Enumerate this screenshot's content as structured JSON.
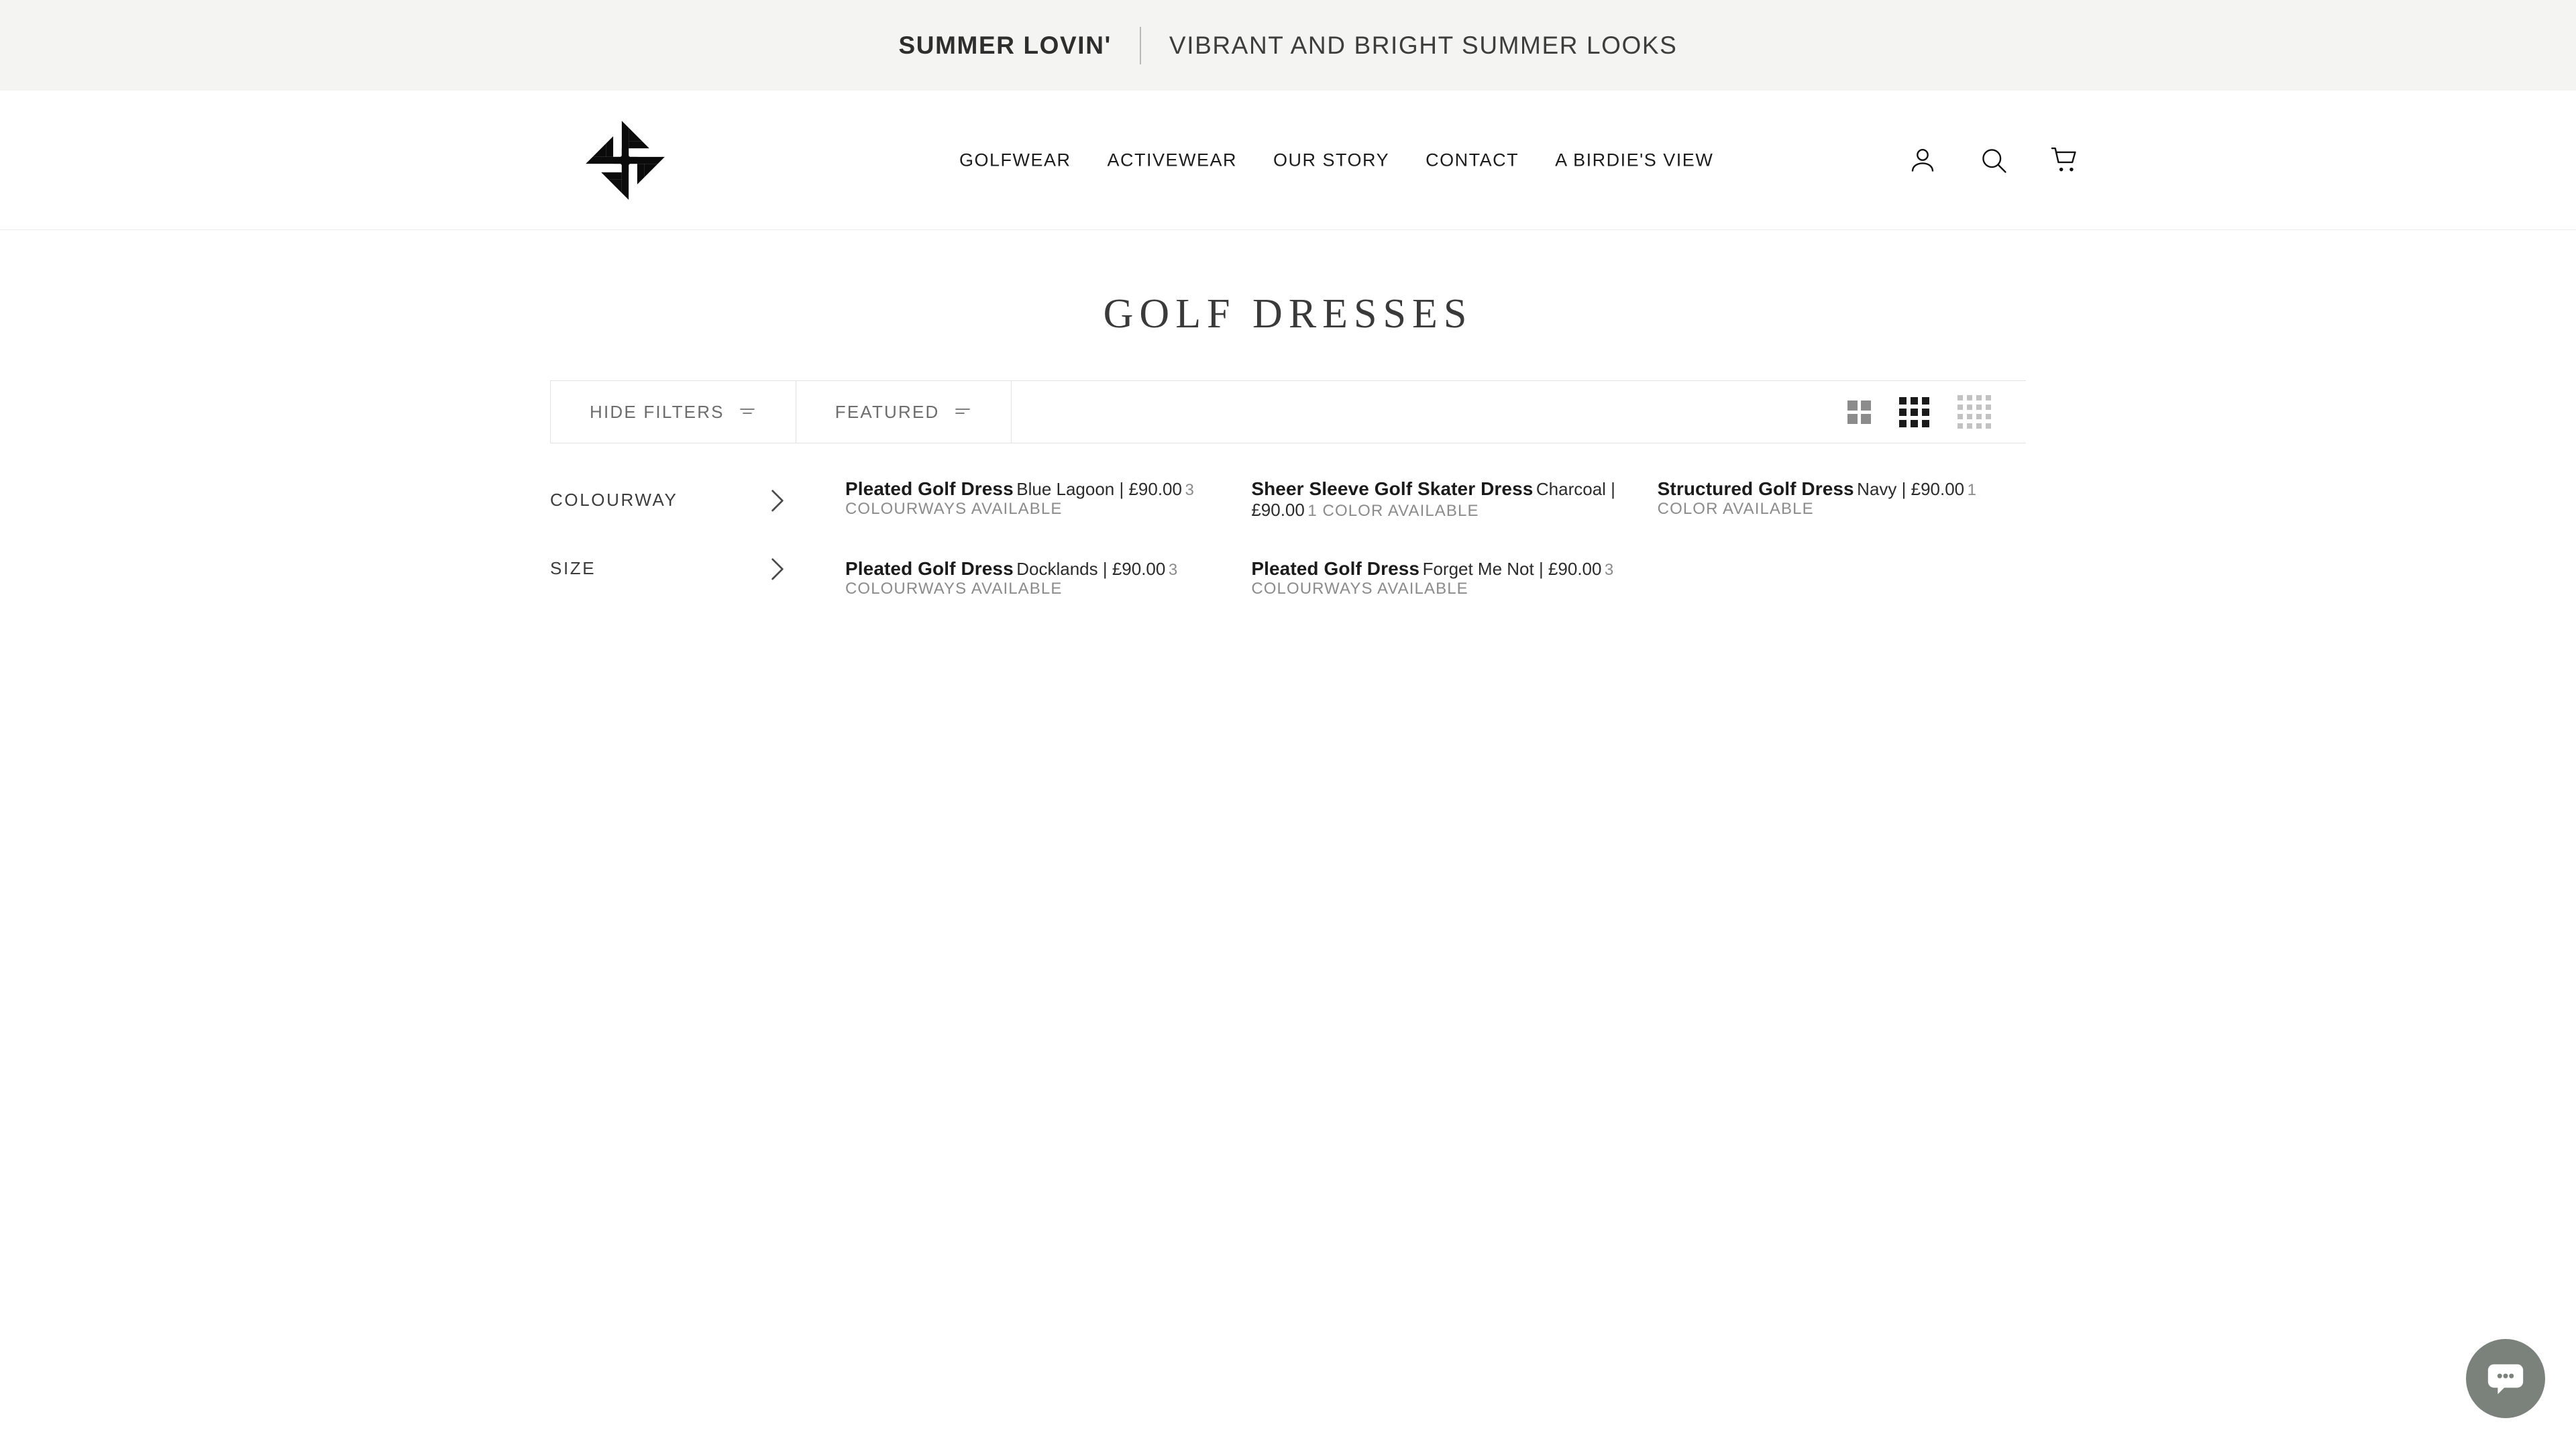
{
  "announcement": {
    "strong_text": "SUMMER LOVIN'",
    "light_text": "VIBRANT AND BRIGHT SUMMER LOOKS"
  },
  "header": {
    "logo_name": "pinwheel-knot-logo",
    "nav": [
      {
        "label": "GOLFWEAR"
      },
      {
        "label": "ACTIVEWEAR"
      },
      {
        "label": "OUR STORY"
      },
      {
        "label": "CONTACT"
      },
      {
        "label": "A BIRDIE'S VIEW"
      }
    ],
    "icons": {
      "account": "account-icon",
      "search": "search-icon",
      "cart": "cart-icon"
    }
  },
  "page": {
    "title": "GOLF DRESSES"
  },
  "filter_bar": {
    "hide_filters_label": "HIDE FILTERS",
    "sort_label": "FEATURED",
    "view_modes": [
      {
        "name": "grid-2-columns",
        "cols": 2,
        "active": false
      },
      {
        "name": "grid-3-columns",
        "cols": 3,
        "active": true
      },
      {
        "name": "grid-4-columns",
        "cols": 4,
        "active": false
      }
    ]
  },
  "sidebar": {
    "filters": [
      {
        "label": "COLOURWAY"
      },
      {
        "label": "SIZE"
      }
    ]
  },
  "products": [
    {
      "title": "Pleated Golf Dress",
      "variant": "Blue Lagoon | £90.00",
      "colors": "3 COLOURWAYS AVAILABLE",
      "scene": "blue-shutters"
    },
    {
      "title": "Sheer Sleeve Golf Skater Dress",
      "variant": "Charcoal | £90.00",
      "colors": "1 COLOR AVAILABLE",
      "scene": "charcoal-studio"
    },
    {
      "title": "Structured Golf Dress",
      "variant": "Navy | £90.00",
      "colors": "1 COLOR AVAILABLE",
      "scene": "navy-studio"
    },
    {
      "title": "Pleated Golf Dress",
      "variant": "Docklands | £90.00",
      "colors": "3 COLOURWAYS AVAILABLE",
      "scene": "docklands-wall"
    },
    {
      "title": "Pleated Golf Dress",
      "variant": "Forget Me Not | £90.00",
      "colors": "3 COLOURWAYS AVAILABLE",
      "scene": "floral-wall"
    }
  ],
  "chat": {
    "name": "chat-widget-button"
  },
  "colors": {
    "announcement_bg": "#f4f4f2",
    "text_dark": "#1b1b1b",
    "text_muted": "#8b8b8b",
    "border": "#e2e2e2",
    "chat_bg": "#7b827b"
  }
}
